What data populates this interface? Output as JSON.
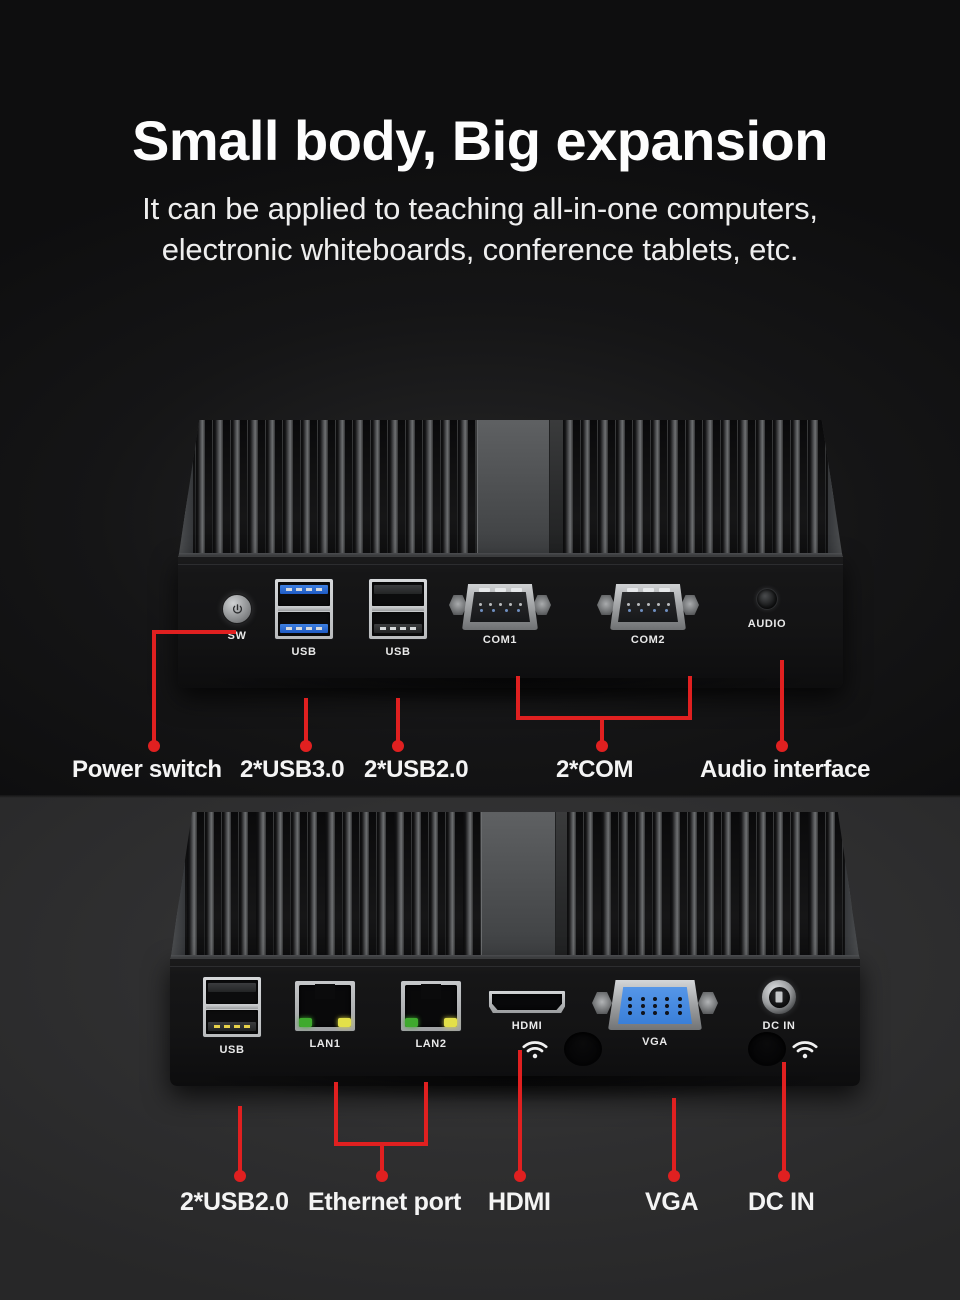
{
  "header": {
    "headline": "Small body, Big expansion",
    "subline_line1": "It can be applied to teaching all-in-one computers,",
    "subline_line2": "electronic whiteboards, conference tablets, etc."
  },
  "colors": {
    "leader_red": "#e02020",
    "usb3_blue": "#3e7fe0",
    "vga_blue": "#5596e8",
    "lan_led_green": "#3faa2e",
    "lan_led_yellow": "#e3e049",
    "background_top": "#101011",
    "background_bottom": "#2e2e2f",
    "text_white": "#f4f4f4"
  },
  "front_panel": {
    "port_labels": {
      "power": "SW",
      "usb3": "USB",
      "usb2": "USB",
      "com1": "COM1",
      "com2": "COM2",
      "audio": "AUDIO"
    },
    "annotations": [
      {
        "label": "Power switch"
      },
      {
        "label": "2*USB3.0"
      },
      {
        "label": "2*USB2.0"
      },
      {
        "label": "2*COM"
      },
      {
        "label": "Audio interface"
      }
    ]
  },
  "rear_panel": {
    "port_labels": {
      "usb": "USB",
      "lan1": "LAN1",
      "lan2": "LAN2",
      "hdmi": "HDMI",
      "vga": "VGA",
      "dc": "DC IN"
    },
    "annotations": [
      {
        "label": "2*USB2.0"
      },
      {
        "label": "Ethernet port"
      },
      {
        "label": "HDMI"
      },
      {
        "label": "VGA"
      },
      {
        "label": "DC IN"
      }
    ]
  }
}
